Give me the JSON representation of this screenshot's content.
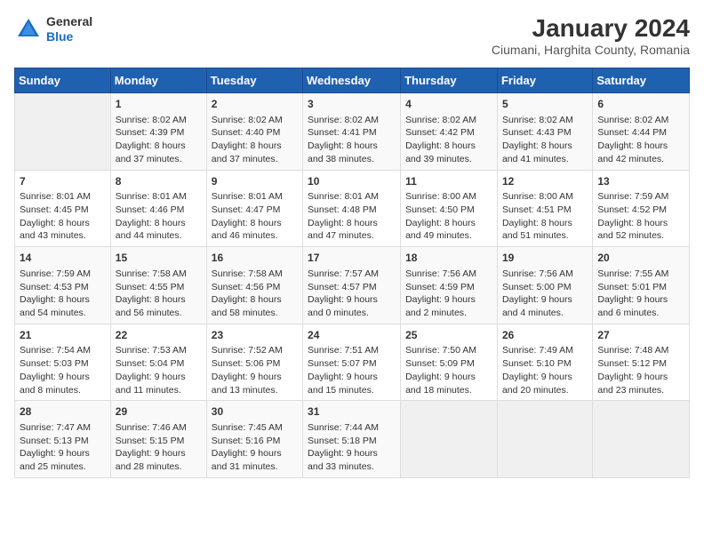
{
  "logo": {
    "general": "General",
    "blue": "Blue"
  },
  "title": "January 2024",
  "subtitle": "Ciumani, Harghita County, Romania",
  "days_header": [
    "Sunday",
    "Monday",
    "Tuesday",
    "Wednesday",
    "Thursday",
    "Friday",
    "Saturday"
  ],
  "weeks": [
    [
      {
        "day": "",
        "info": ""
      },
      {
        "day": "1",
        "info": "Sunrise: 8:02 AM\nSunset: 4:39 PM\nDaylight: 8 hours\nand 37 minutes."
      },
      {
        "day": "2",
        "info": "Sunrise: 8:02 AM\nSunset: 4:40 PM\nDaylight: 8 hours\nand 37 minutes."
      },
      {
        "day": "3",
        "info": "Sunrise: 8:02 AM\nSunset: 4:41 PM\nDaylight: 8 hours\nand 38 minutes."
      },
      {
        "day": "4",
        "info": "Sunrise: 8:02 AM\nSunset: 4:42 PM\nDaylight: 8 hours\nand 39 minutes."
      },
      {
        "day": "5",
        "info": "Sunrise: 8:02 AM\nSunset: 4:43 PM\nDaylight: 8 hours\nand 41 minutes."
      },
      {
        "day": "6",
        "info": "Sunrise: 8:02 AM\nSunset: 4:44 PM\nDaylight: 8 hours\nand 42 minutes."
      }
    ],
    [
      {
        "day": "7",
        "info": "Sunrise: 8:01 AM\nSunset: 4:45 PM\nDaylight: 8 hours\nand 43 minutes."
      },
      {
        "day": "8",
        "info": "Sunrise: 8:01 AM\nSunset: 4:46 PM\nDaylight: 8 hours\nand 44 minutes."
      },
      {
        "day": "9",
        "info": "Sunrise: 8:01 AM\nSunset: 4:47 PM\nDaylight: 8 hours\nand 46 minutes."
      },
      {
        "day": "10",
        "info": "Sunrise: 8:01 AM\nSunset: 4:48 PM\nDaylight: 8 hours\nand 47 minutes."
      },
      {
        "day": "11",
        "info": "Sunrise: 8:00 AM\nSunset: 4:50 PM\nDaylight: 8 hours\nand 49 minutes."
      },
      {
        "day": "12",
        "info": "Sunrise: 8:00 AM\nSunset: 4:51 PM\nDaylight: 8 hours\nand 51 minutes."
      },
      {
        "day": "13",
        "info": "Sunrise: 7:59 AM\nSunset: 4:52 PM\nDaylight: 8 hours\nand 52 minutes."
      }
    ],
    [
      {
        "day": "14",
        "info": "Sunrise: 7:59 AM\nSunset: 4:53 PM\nDaylight: 8 hours\nand 54 minutes."
      },
      {
        "day": "15",
        "info": "Sunrise: 7:58 AM\nSunset: 4:55 PM\nDaylight: 8 hours\nand 56 minutes."
      },
      {
        "day": "16",
        "info": "Sunrise: 7:58 AM\nSunset: 4:56 PM\nDaylight: 8 hours\nand 58 minutes."
      },
      {
        "day": "17",
        "info": "Sunrise: 7:57 AM\nSunset: 4:57 PM\nDaylight: 9 hours\nand 0 minutes."
      },
      {
        "day": "18",
        "info": "Sunrise: 7:56 AM\nSunset: 4:59 PM\nDaylight: 9 hours\nand 2 minutes."
      },
      {
        "day": "19",
        "info": "Sunrise: 7:56 AM\nSunset: 5:00 PM\nDaylight: 9 hours\nand 4 minutes."
      },
      {
        "day": "20",
        "info": "Sunrise: 7:55 AM\nSunset: 5:01 PM\nDaylight: 9 hours\nand 6 minutes."
      }
    ],
    [
      {
        "day": "21",
        "info": "Sunrise: 7:54 AM\nSunset: 5:03 PM\nDaylight: 9 hours\nand 8 minutes."
      },
      {
        "day": "22",
        "info": "Sunrise: 7:53 AM\nSunset: 5:04 PM\nDaylight: 9 hours\nand 11 minutes."
      },
      {
        "day": "23",
        "info": "Sunrise: 7:52 AM\nSunset: 5:06 PM\nDaylight: 9 hours\nand 13 minutes."
      },
      {
        "day": "24",
        "info": "Sunrise: 7:51 AM\nSunset: 5:07 PM\nDaylight: 9 hours\nand 15 minutes."
      },
      {
        "day": "25",
        "info": "Sunrise: 7:50 AM\nSunset: 5:09 PM\nDaylight: 9 hours\nand 18 minutes."
      },
      {
        "day": "26",
        "info": "Sunrise: 7:49 AM\nSunset: 5:10 PM\nDaylight: 9 hours\nand 20 minutes."
      },
      {
        "day": "27",
        "info": "Sunrise: 7:48 AM\nSunset: 5:12 PM\nDaylight: 9 hours\nand 23 minutes."
      }
    ],
    [
      {
        "day": "28",
        "info": "Sunrise: 7:47 AM\nSunset: 5:13 PM\nDaylight: 9 hours\nand 25 minutes."
      },
      {
        "day": "29",
        "info": "Sunrise: 7:46 AM\nSunset: 5:15 PM\nDaylight: 9 hours\nand 28 minutes."
      },
      {
        "day": "30",
        "info": "Sunrise: 7:45 AM\nSunset: 5:16 PM\nDaylight: 9 hours\nand 31 minutes."
      },
      {
        "day": "31",
        "info": "Sunrise: 7:44 AM\nSunset: 5:18 PM\nDaylight: 9 hours\nand 33 minutes."
      },
      {
        "day": "",
        "info": ""
      },
      {
        "day": "",
        "info": ""
      },
      {
        "day": "",
        "info": ""
      }
    ]
  ]
}
